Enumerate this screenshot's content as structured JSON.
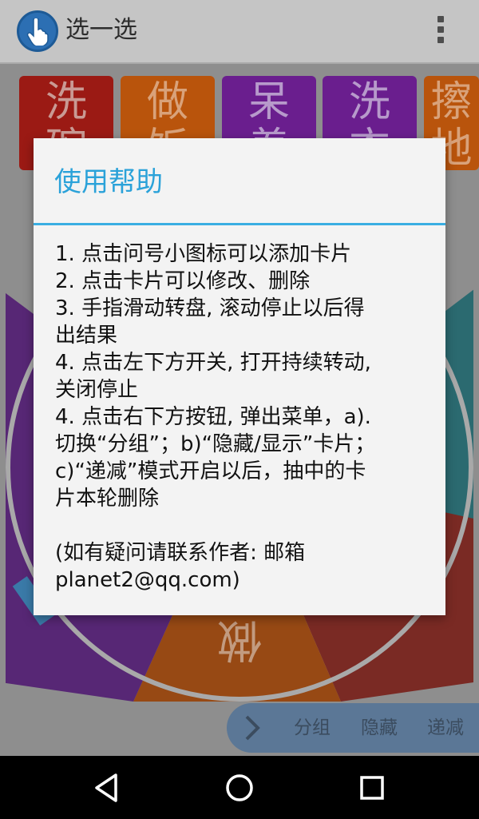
{
  "app": {
    "title": "选一选",
    "icon": "hand-pointer-icon",
    "menu_icon": "overflow-menu-icon"
  },
  "cards": [
    {
      "text": "洗碗",
      "color": "#9b1a14",
      "text_color": "#c99a94"
    },
    {
      "text": "做饭",
      "color": "#b9540c",
      "text_color": "#d9a27a"
    },
    {
      "text": "呆着",
      "color": "#6a1e8e",
      "text_color": "#b79acb"
    },
    {
      "text": "洗衣",
      "color": "#6a1e8e",
      "text_color": "#b79acb"
    },
    {
      "text": "擦地",
      "color": "#b9540c",
      "text_color": "#d9a27a"
    }
  ],
  "wheel": {
    "bottom_label": "做"
  },
  "toolbar": {
    "group": "分组",
    "hide": "隐藏",
    "decrease": "递减"
  },
  "dialog": {
    "title": "使用帮助",
    "lines": [
      "1. 点击问号小图标可以添加卡片",
      "2. 点击卡片可以修改、删除",
      "3. 手指滑动转盘, 滚动停止以后得",
      "出结果",
      "4. 点击左下方开关, 打开持续转动,",
      "关闭停止",
      "4. 点击右下方按钮, 弹出菜单，a).",
      "切换“分组”；b)“隐藏/显示”卡片；",
      "c)“递减”模式开启以后，抽中的卡",
      "片本轮删除",
      "",
      " (如有疑问请联系作者: 邮箱",
      "planet2@qq.com)"
    ]
  },
  "nav": {
    "back": "back-icon",
    "home": "home-icon",
    "recents": "recents-icon"
  }
}
